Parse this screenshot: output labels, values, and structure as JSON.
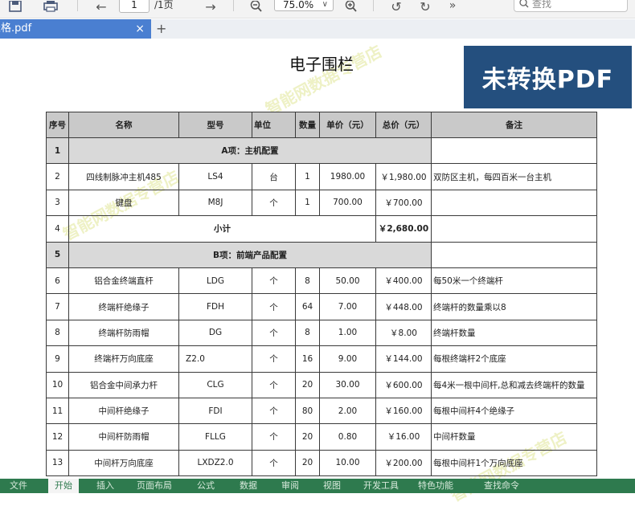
{
  "toolbar": {
    "page_current": "1",
    "page_total": "/1页",
    "zoom": "75.0%",
    "search_placeholder": "查找",
    "more": "»"
  },
  "tab": {
    "filename": "表格.pdf",
    "close": "×",
    "new_tab": "+"
  },
  "document": {
    "title": "电子围栏",
    "banner": "未转换PDF",
    "watermark": "智能网数据专营店"
  },
  "table": {
    "headers": [
      "序号",
      "名称",
      "型号",
      "单位",
      "数量",
      "单价（元）",
      "总价（元）",
      "备注"
    ],
    "rows": [
      {
        "kind": "section",
        "no": "1",
        "label": "A项：主机配置"
      },
      {
        "kind": "item",
        "no": "2",
        "name": "四线制脉冲主机485",
        "model": "LS4",
        "unit": "台",
        "qty": "1",
        "price": "1980.00",
        "total": "￥1,980.00",
        "note": "双防区主机，每四百米一台主机"
      },
      {
        "kind": "item",
        "no": "3",
        "name": "键盘",
        "model": "M8J",
        "unit": "个",
        "qty": "1",
        "price": "700.00",
        "total": "￥700.00",
        "note": ""
      },
      {
        "kind": "subtotal",
        "no": "4",
        "label": "小计",
        "total": "￥2,680.00"
      },
      {
        "kind": "section",
        "no": "5",
        "label": "B项：前端产品配置"
      },
      {
        "kind": "item",
        "no": "6",
        "name": "铝合金终端直杆",
        "model": "LDG",
        "unit": "个",
        "qty": "8",
        "price": "50.00",
        "total": "￥400.00",
        "note": "每50米一个终端杆"
      },
      {
        "kind": "item",
        "no": "7",
        "name": "终端杆绝缘子",
        "model": "FDH",
        "unit": "个",
        "qty": "64",
        "price": "7.00",
        "total": "￥448.00",
        "note": "终端杆的数量乘以8"
      },
      {
        "kind": "item",
        "no": "8",
        "name": "终端杆防雨帽",
        "model": "DG",
        "unit": "个",
        "qty": "8",
        "price": "1.00",
        "total": "￥8.00",
        "note": "终端杆数量"
      },
      {
        "kind": "item",
        "no": "9",
        "name": "终端杆万向底座",
        "model": "Z2.0",
        "unit": "个",
        "qty": "16",
        "price": "9.00",
        "total": "￥144.00",
        "note": "每根终端杆2个底座"
      },
      {
        "kind": "item",
        "no": "10",
        "name": "铝合金中间承力杆",
        "model": "CLG",
        "unit": "个",
        "qty": "20",
        "price": "30.00",
        "total": "￥600.00",
        "note": "每4米一根中间杆,总和减去终端杆的数量"
      },
      {
        "kind": "item",
        "no": "11",
        "name": "中间杆绝缘子",
        "model": "FDI",
        "unit": "个",
        "qty": "80",
        "price": "2.00",
        "total": "￥160.00",
        "note": "每根中间杆4个绝缘子"
      },
      {
        "kind": "item",
        "no": "12",
        "name": "中间杆防雨帽",
        "model": "FLLG",
        "unit": "个",
        "qty": "20",
        "price": "0.80",
        "total": "￥16.00",
        "note": "中间杆数量"
      },
      {
        "kind": "item",
        "no": "13",
        "name": "中间杆万向底座",
        "model": "LXDZ2.0",
        "unit": "个",
        "qty": "20",
        "price": "10.00",
        "total": "￥200.00",
        "note": "每根中间杆1个万向底座"
      }
    ]
  },
  "ribbon": {
    "items": [
      "文件",
      "开始",
      "插入",
      "页面布局",
      "公式",
      "数据",
      "审阅",
      "视图",
      "开发工具",
      "特色功能",
      "查找命令"
    ],
    "active_index": 1
  }
}
